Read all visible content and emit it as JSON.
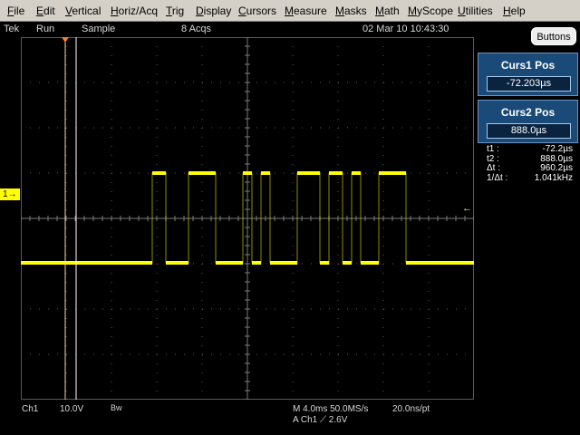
{
  "menu": {
    "items": [
      "File",
      "Edit",
      "Vertical",
      "Horiz/Acq",
      "Trig",
      "Display",
      "Cursors",
      "Measure",
      "Masks",
      "Math",
      "MyScope",
      "Utilities",
      "Help"
    ]
  },
  "status": {
    "brand": "Tek",
    "run_state": "Run",
    "mode": "Sample",
    "acqs": "8 Acqs",
    "datetime": "02 Mar 10 10:43:30"
  },
  "buttons_label": "Buttons",
  "cursors": {
    "curs1": {
      "title": "Curs1 Pos",
      "value": "-72.203µs"
    },
    "curs2": {
      "title": "Curs2 Pos",
      "value": "888.0µs"
    }
  },
  "readout": [
    {
      "label": "t1 :",
      "value": "-72.2µs"
    },
    {
      "label": "t2 :",
      "value": "888.0µs"
    },
    {
      "label": "Δt :",
      "value": "960.2µs"
    },
    {
      "label": "1/Δt :",
      "value": "1.041kHz"
    }
  ],
  "bottom": {
    "channel": "Ch1",
    "scale": "10.0V",
    "bw": "Bw",
    "horizontal": "M 4.0ms 50.0MS/s",
    "resolution": "20.0ns/pt",
    "trigger": "A  Ch1  ⟋  2.6V"
  },
  "channel_marker": "1",
  "colors": {
    "trace": "#ffff00",
    "grid": "#5a5a5a",
    "panel": "#1a4a78"
  },
  "waveform": {
    "high_segments": [
      [
        -2.1,
        -1.8
      ],
      [
        -1.3,
        -0.7
      ],
      [
        -0.1,
        0.1
      ],
      [
        0.3,
        0.5
      ],
      [
        1.1,
        1.6
      ],
      [
        1.8,
        2.1
      ],
      [
        2.3,
        2.5
      ],
      [
        2.9,
        3.5
      ]
    ],
    "low_start": -5.0,
    "end_low_from": 3.5,
    "end": 5.0
  }
}
